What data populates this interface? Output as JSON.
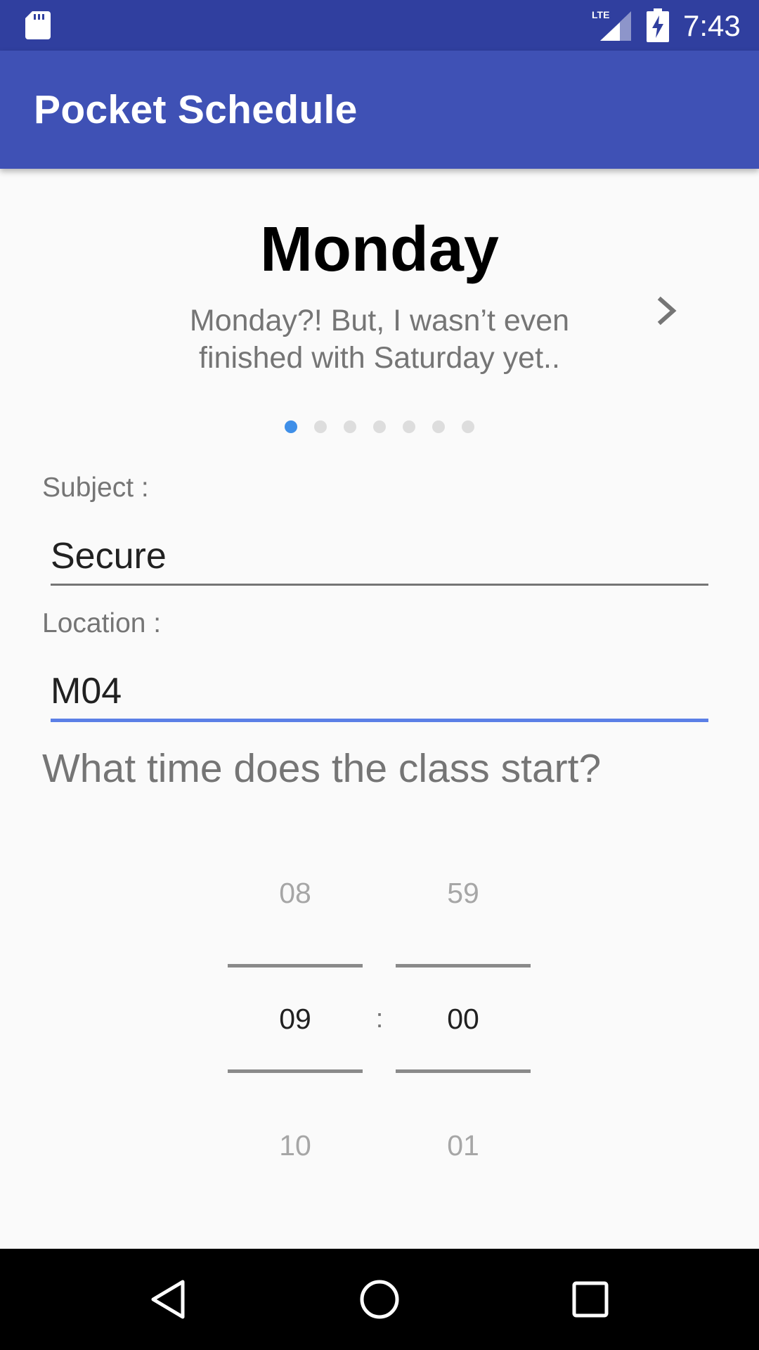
{
  "status_bar": {
    "time": "7:43",
    "icons": [
      "sd-card-icon",
      "lte-signal-icon",
      "battery-charging-icon"
    ]
  },
  "app_bar": {
    "title": "Pocket Schedule"
  },
  "day_pager": {
    "day": "Monday",
    "subtitle_line1": "Monday?! But, I wasn’t even",
    "subtitle_line2": "finished with Saturday yet..",
    "next_icon": "chevron-right-icon",
    "page_count": 7,
    "current_page": 1
  },
  "form": {
    "subject_label": "Subject :",
    "subject_value": "Secure",
    "location_label": "Location :",
    "location_value": "M04",
    "question": "What time does the class start?"
  },
  "time_picker": {
    "hour_prev": "08",
    "hour_selected": "09",
    "hour_next": "10",
    "minute_prev": "59",
    "minute_selected": "00",
    "minute_next": "01",
    "separator": ":"
  },
  "nav_bar": {
    "icons": [
      "back-icon",
      "home-icon",
      "recents-icon"
    ]
  },
  "colors": {
    "status_bar": "#303f9f",
    "app_bar": "#3f51b5",
    "accent": "#5b7fe6",
    "active_dot": "#3f8fe8"
  }
}
